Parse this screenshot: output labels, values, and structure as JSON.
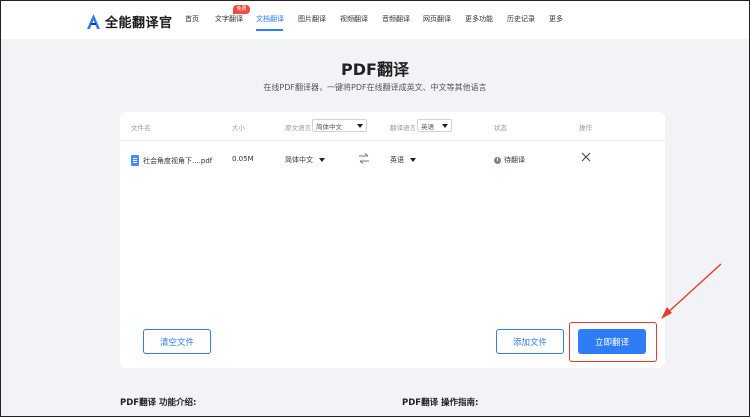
{
  "app": {
    "name": "全能翻译官"
  },
  "nav": {
    "items": [
      {
        "label": "首页"
      },
      {
        "label": "文字翻译"
      },
      {
        "label": "文档翻译"
      },
      {
        "label": "图片翻译"
      },
      {
        "label": "视频翻译"
      },
      {
        "label": "音频翻译"
      },
      {
        "label": "网页翻译"
      },
      {
        "label": "更多功能"
      },
      {
        "label": "历史记录"
      },
      {
        "label": "更多"
      }
    ],
    "active_index": 2,
    "badge": "免费"
  },
  "page": {
    "title": "PDF翻译",
    "subtitle": "在线PDF翻译器，一键将PDF在线翻译成英文、中文等其他语言"
  },
  "table": {
    "headers": {
      "filename": "文件名",
      "size": "大小",
      "source_lang": "原文语言",
      "target_lang": "翻译语言",
      "status": "状态",
      "action": "操作"
    },
    "source_lang_select": "简体中文",
    "target_lang_select": "英语",
    "rows": [
      {
        "filename": "社会角度视角下....pdf",
        "size": "0.05M",
        "source_lang": "简体中文",
        "target_lang": "英语",
        "status": "待翻译"
      }
    ]
  },
  "buttons": {
    "clear": "清空文件",
    "add": "添加文件",
    "translate": "立即翻译"
  },
  "bottom": {
    "intro": "PDF翻译 功能介绍:",
    "guide": "PDF翻译 操作指南:"
  },
  "colors": {
    "accent": "#2f7cf6",
    "highlight": "#e53b2c",
    "background": "#f2f3f6"
  },
  "icons": [
    "logo-a-icon",
    "file-icon",
    "swap-icon",
    "status-clock-icon",
    "close-icon",
    "chevron-down-icon"
  ]
}
